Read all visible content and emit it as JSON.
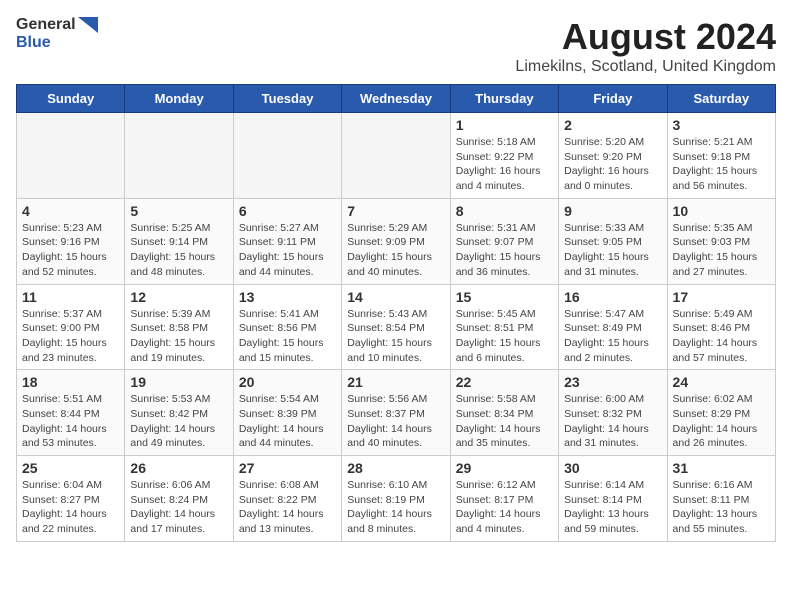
{
  "logo": {
    "general": "General",
    "blue": "Blue"
  },
  "title": "August 2024",
  "subtitle": "Limekilns, Scotland, United Kingdom",
  "headers": [
    "Sunday",
    "Monday",
    "Tuesday",
    "Wednesday",
    "Thursday",
    "Friday",
    "Saturday"
  ],
  "weeks": [
    [
      {
        "day": "",
        "empty": true
      },
      {
        "day": "",
        "empty": true
      },
      {
        "day": "",
        "empty": true
      },
      {
        "day": "",
        "empty": true
      },
      {
        "day": "1",
        "sunrise": "5:18 AM",
        "sunset": "9:22 PM",
        "daylight": "16 hours and 4 minutes."
      },
      {
        "day": "2",
        "sunrise": "5:20 AM",
        "sunset": "9:20 PM",
        "daylight": "16 hours and 0 minutes."
      },
      {
        "day": "3",
        "sunrise": "5:21 AM",
        "sunset": "9:18 PM",
        "daylight": "15 hours and 56 minutes."
      }
    ],
    [
      {
        "day": "4",
        "sunrise": "5:23 AM",
        "sunset": "9:16 PM",
        "daylight": "15 hours and 52 minutes."
      },
      {
        "day": "5",
        "sunrise": "5:25 AM",
        "sunset": "9:14 PM",
        "daylight": "15 hours and 48 minutes."
      },
      {
        "day": "6",
        "sunrise": "5:27 AM",
        "sunset": "9:11 PM",
        "daylight": "15 hours and 44 minutes."
      },
      {
        "day": "7",
        "sunrise": "5:29 AM",
        "sunset": "9:09 PM",
        "daylight": "15 hours and 40 minutes."
      },
      {
        "day": "8",
        "sunrise": "5:31 AM",
        "sunset": "9:07 PM",
        "daylight": "15 hours and 36 minutes."
      },
      {
        "day": "9",
        "sunrise": "5:33 AM",
        "sunset": "9:05 PM",
        "daylight": "15 hours and 31 minutes."
      },
      {
        "day": "10",
        "sunrise": "5:35 AM",
        "sunset": "9:03 PM",
        "daylight": "15 hours and 27 minutes."
      }
    ],
    [
      {
        "day": "11",
        "sunrise": "5:37 AM",
        "sunset": "9:00 PM",
        "daylight": "15 hours and 23 minutes."
      },
      {
        "day": "12",
        "sunrise": "5:39 AM",
        "sunset": "8:58 PM",
        "daylight": "15 hours and 19 minutes."
      },
      {
        "day": "13",
        "sunrise": "5:41 AM",
        "sunset": "8:56 PM",
        "daylight": "15 hours and 15 minutes."
      },
      {
        "day": "14",
        "sunrise": "5:43 AM",
        "sunset": "8:54 PM",
        "daylight": "15 hours and 10 minutes."
      },
      {
        "day": "15",
        "sunrise": "5:45 AM",
        "sunset": "8:51 PM",
        "daylight": "15 hours and 6 minutes."
      },
      {
        "day": "16",
        "sunrise": "5:47 AM",
        "sunset": "8:49 PM",
        "daylight": "15 hours and 2 minutes."
      },
      {
        "day": "17",
        "sunrise": "5:49 AM",
        "sunset": "8:46 PM",
        "daylight": "14 hours and 57 minutes."
      }
    ],
    [
      {
        "day": "18",
        "sunrise": "5:51 AM",
        "sunset": "8:44 PM",
        "daylight": "14 hours and 53 minutes."
      },
      {
        "day": "19",
        "sunrise": "5:53 AM",
        "sunset": "8:42 PM",
        "daylight": "14 hours and 49 minutes."
      },
      {
        "day": "20",
        "sunrise": "5:54 AM",
        "sunset": "8:39 PM",
        "daylight": "14 hours and 44 minutes."
      },
      {
        "day": "21",
        "sunrise": "5:56 AM",
        "sunset": "8:37 PM",
        "daylight": "14 hours and 40 minutes."
      },
      {
        "day": "22",
        "sunrise": "5:58 AM",
        "sunset": "8:34 PM",
        "daylight": "14 hours and 35 minutes."
      },
      {
        "day": "23",
        "sunrise": "6:00 AM",
        "sunset": "8:32 PM",
        "daylight": "14 hours and 31 minutes."
      },
      {
        "day": "24",
        "sunrise": "6:02 AM",
        "sunset": "8:29 PM",
        "daylight": "14 hours and 26 minutes."
      }
    ],
    [
      {
        "day": "25",
        "sunrise": "6:04 AM",
        "sunset": "8:27 PM",
        "daylight": "14 hours and 22 minutes."
      },
      {
        "day": "26",
        "sunrise": "6:06 AM",
        "sunset": "8:24 PM",
        "daylight": "14 hours and 17 minutes."
      },
      {
        "day": "27",
        "sunrise": "6:08 AM",
        "sunset": "8:22 PM",
        "daylight": "14 hours and 13 minutes."
      },
      {
        "day": "28",
        "sunrise": "6:10 AM",
        "sunset": "8:19 PM",
        "daylight": "14 hours and 8 minutes."
      },
      {
        "day": "29",
        "sunrise": "6:12 AM",
        "sunset": "8:17 PM",
        "daylight": "14 hours and 4 minutes."
      },
      {
        "day": "30",
        "sunrise": "6:14 AM",
        "sunset": "8:14 PM",
        "daylight": "13 hours and 59 minutes."
      },
      {
        "day": "31",
        "sunrise": "6:16 AM",
        "sunset": "8:11 PM",
        "daylight": "13 hours and 55 minutes."
      }
    ]
  ],
  "labels": {
    "sunrise_prefix": "Sunrise: ",
    "sunset_prefix": "Sunset: ",
    "daylight_prefix": "Daylight: "
  }
}
